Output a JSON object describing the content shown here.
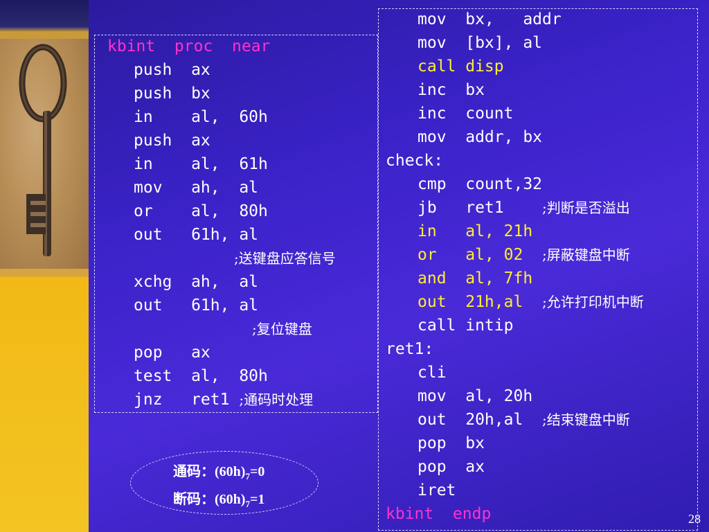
{
  "left_code": [
    {
      "text": "kbint  proc  near",
      "style": "head"
    },
    {
      "text": "push  ax"
    },
    {
      "text": "push  bx"
    },
    {
      "text": "in    al,  60h"
    },
    {
      "text": "push  ax"
    },
    {
      "text": "in    al,  61h"
    },
    {
      "text": "mov   ah,  al"
    },
    {
      "text": "or    al,  80h"
    },
    {
      "text": "out   61h, al"
    },
    {
      "comment": ";送键盘应答信号"
    },
    {
      "text": "xchg  ah,  al"
    },
    {
      "text": "out   61h, al"
    },
    {
      "comment": ";复位键盘"
    },
    {
      "text": "pop   ax"
    },
    {
      "text": "test  al,  80h"
    },
    {
      "text": "jnz   ret1 ",
      "comment": ";通码时处理"
    }
  ],
  "right_code": [
    {
      "text": "mov  bx,   addr"
    },
    {
      "text": "mov  [bx], al"
    },
    {
      "text": "call disp",
      "style": "yellow"
    },
    {
      "text": "inc  bx"
    },
    {
      "text": "inc  count"
    },
    {
      "text": "mov  addr, bx"
    },
    {
      "text": "check:",
      "style": "label"
    },
    {
      "text": "cmp  count,32"
    },
    {
      "text": "jb   ret1    ",
      "comment": ";判断是否溢出"
    },
    {
      "text": "in   al, 21h",
      "style": "yellow"
    },
    {
      "text": "or   al, 02  ",
      "style": "yellow",
      "comment": ";屏蔽键盘中断"
    },
    {
      "text": "and  al, 7fh",
      "style": "yellow"
    },
    {
      "text": "out  21h,al  ",
      "style": "yellow",
      "comment": ";允许打印机中断"
    },
    {
      "text": "call intip"
    },
    {
      "text": "ret1:",
      "style": "label"
    },
    {
      "text": "cli"
    },
    {
      "text": "mov  al, 20h"
    },
    {
      "text": "out  20h,al  ",
      "comment": ";结束键盘中断"
    },
    {
      "text": "pop  bx"
    },
    {
      "text": "pop  ax"
    },
    {
      "text": "iret"
    },
    {
      "text": "kbint  endp",
      "style": "head"
    }
  ],
  "notes": {
    "make_code": {
      "prefix": "通码：(60h)",
      "sub": "7",
      "suffix": "=0"
    },
    "break_code": {
      "prefix": "断码：(60h)",
      "sub": "7",
      "suffix": "=1"
    }
  },
  "page_number": "28",
  "colors": {
    "keyword_head": "#ff33cc",
    "highlight": "#ffee33",
    "text": "#ffffff"
  },
  "icons": {
    "decoration": "antique-key-image"
  }
}
